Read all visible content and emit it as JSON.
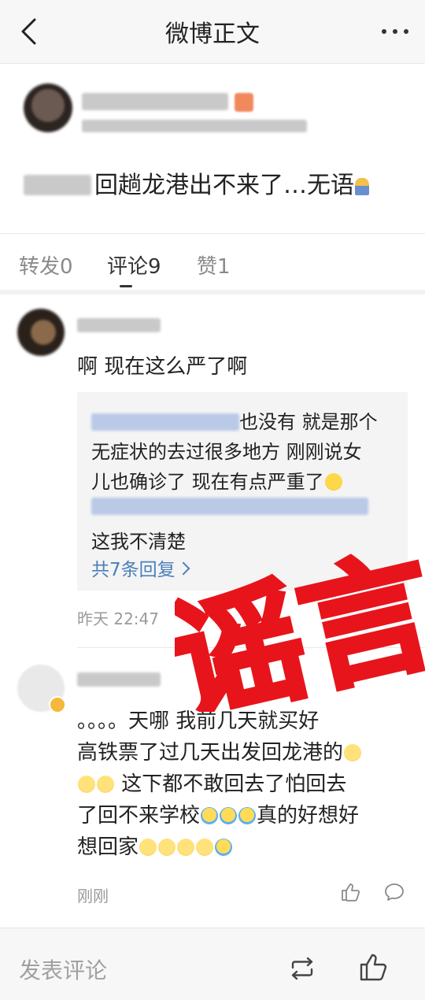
{
  "nav": {
    "title": "微博正文"
  },
  "post": {
    "text": "回趟龙港出不来了…无语"
  },
  "tabs": [
    {
      "label": "转发0"
    },
    {
      "label": "评论9"
    },
    {
      "label": "赞1"
    }
  ],
  "comments": [
    {
      "text": "啊 现在这么严了啊",
      "reply": {
        "line1": "也没有 就是那个",
        "line2": "无症状的去过很多地方 刚刚说女",
        "line3": "儿也确诊了 现在有点严重了",
        "line5": "这我不清楚",
        "more": "共7条回复"
      },
      "time": "昨天 22:47"
    },
    {
      "lines": [
        "。。。。天哪 我前几天就买好",
        "高铁票了过几天出发回龙港的",
        " 这下都不敢回去了怕回去",
        "了回不来学校",
        "真的好想好",
        "想回家"
      ],
      "time": "刚刚"
    }
  ],
  "stamp": {
    "text": "谣言",
    "color": "#e8141b"
  },
  "bottom_bar": {
    "comment_placeholder": "发表评论"
  },
  "icons": [
    "back-icon",
    "more-icon",
    "like-icon",
    "comment-icon",
    "repost-icon",
    "thumbs-up-icon"
  ]
}
